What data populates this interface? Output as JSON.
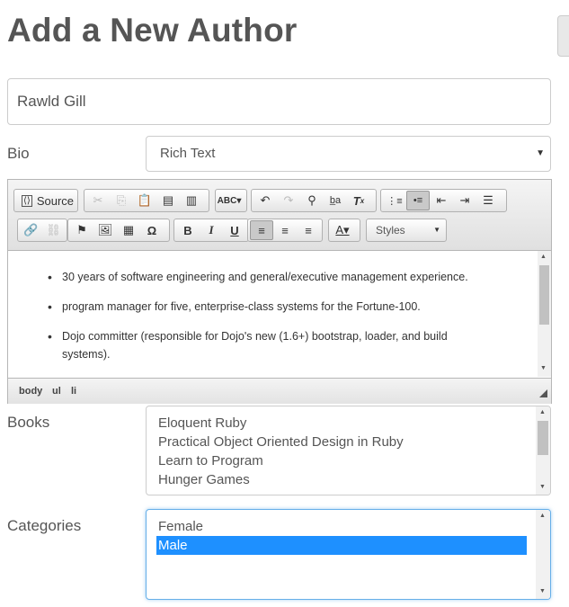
{
  "page": {
    "title": "Add a New Author"
  },
  "name_field": {
    "value": "Rawld Gill"
  },
  "bio": {
    "label": "Bio",
    "select_value": "Rich Text",
    "editor": {
      "toolbar": {
        "source_label": "Source",
        "styles_label": "Styles"
      },
      "content_items": [
        "30 years of software engineering and general/executive management experience.",
        "program manager for five, enterprise-class systems for the Fortune-100.",
        "Dojo committer (responsible for Dojo's new (1.6+) bootstrap, loader, and build systems)."
      ],
      "path": [
        "body",
        "ul",
        "li"
      ]
    }
  },
  "books": {
    "label": "Books",
    "options": [
      "Eloquent Ruby",
      "Practical Object Oriented Design in Ruby",
      "Learn to Program",
      "Hunger Games"
    ]
  },
  "categories": {
    "label": "Categories",
    "options": [
      "Female",
      "Male"
    ],
    "selected": "Male"
  },
  "colors": {
    "selection": "#1e90ff",
    "focus_border": "#66afe9"
  }
}
